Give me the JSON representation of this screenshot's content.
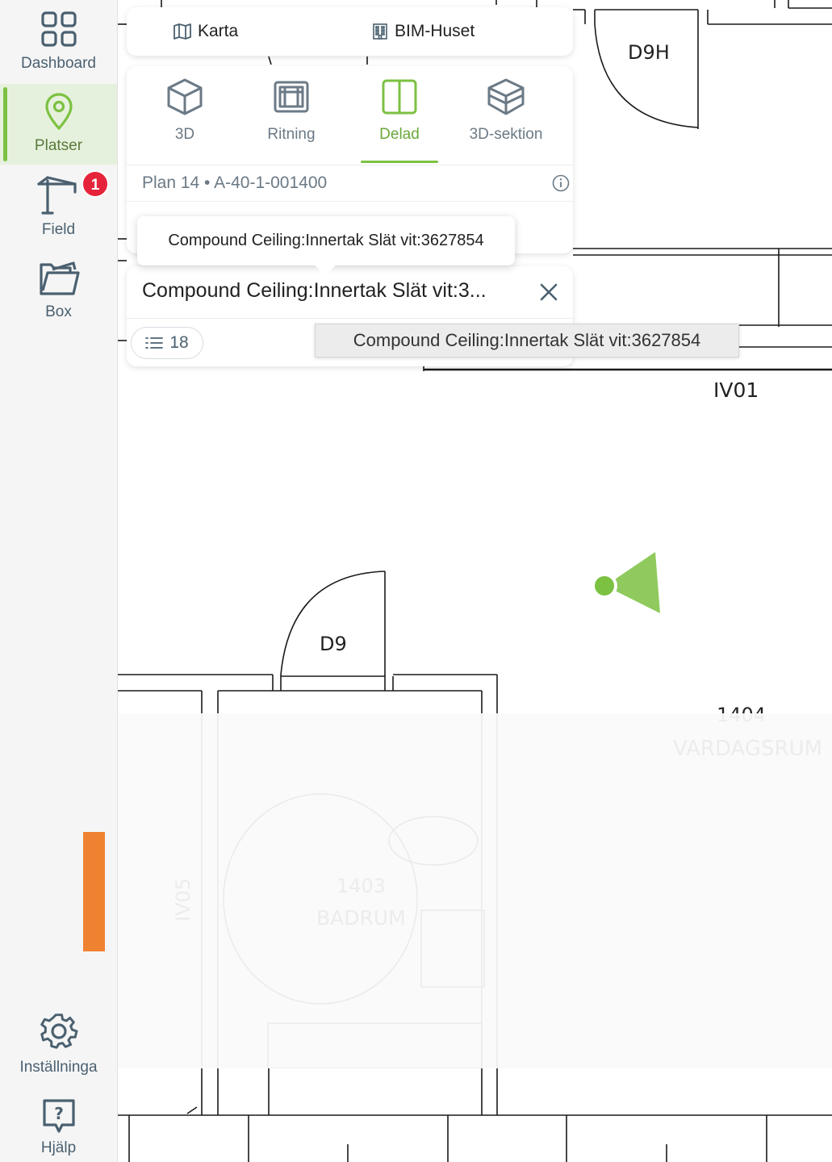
{
  "sidebar": {
    "items": [
      {
        "label": "Dashboard",
        "icon": "dashboard-icon"
      },
      {
        "label": "Platser",
        "icon": "location-pin-icon",
        "active": true
      },
      {
        "label": "Field",
        "icon": "crane-icon",
        "badge": "1"
      },
      {
        "label": "Box",
        "icon": "folder-icon"
      }
    ],
    "bottom_items": [
      {
        "label": "Inställninga",
        "icon": "gear-icon"
      },
      {
        "label": "Hjälp",
        "icon": "help-icon"
      }
    ]
  },
  "top_toggle": {
    "map_label": "Karta",
    "map_icon": "map-icon",
    "building_label": "BIM-Huset",
    "building_icon": "building-icon"
  },
  "view_modes": {
    "items": [
      {
        "label": "3D",
        "icon": "cube-icon"
      },
      {
        "label": "Ritning",
        "icon": "drawing-icon"
      },
      {
        "label": "Delad",
        "icon": "split-view-icon",
        "active": true
      },
      {
        "label": "3D-sektion",
        "icon": "cube-section-icon"
      }
    ]
  },
  "plan": {
    "label": "Plan 14 • A-40-1-001400"
  },
  "tooltip_top": "Compound Ceiling:Innertak Slät vit:3627854",
  "object_card": {
    "title": "Compound Ceiling:Innertak Slät vit:3...",
    "count": "18"
  },
  "tooltip_hover": "Compound Ceiling:Innertak Slät vit:3627854",
  "floorplan": {
    "labels": {
      "door_d9h": "D9H",
      "door_d9": "D9",
      "wall_iv01": "IV01",
      "partial_top": "D9H",
      "room_1404_num": "1404",
      "room_1404_name": "VARDAGSRUM",
      "room_1403_num": "1403",
      "room_1403_name": "BADRUM",
      "wall_iv05": "IV05"
    }
  },
  "colors": {
    "accent_green": "#7cc142",
    "badge_red": "#e5243b",
    "orange": "#ef8230",
    "sidebar_bg": "#f5f5f5"
  }
}
